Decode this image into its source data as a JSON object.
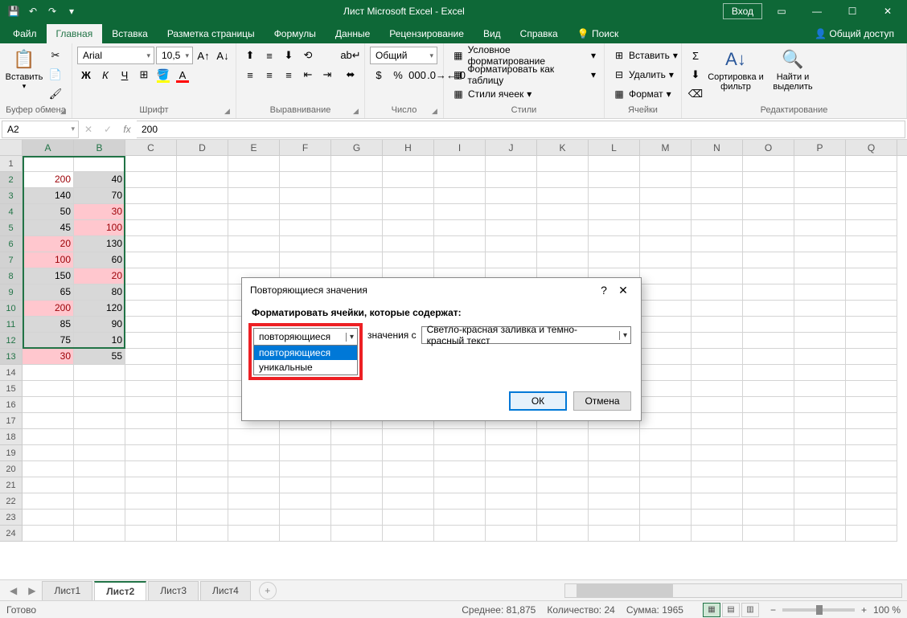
{
  "title": "Лист Microsoft Excel  -  Excel",
  "login": "Вход",
  "tabs": [
    "Файл",
    "Главная",
    "Вставка",
    "Разметка страницы",
    "Формулы",
    "Данные",
    "Рецензирование",
    "Вид",
    "Справка",
    "Поиск"
  ],
  "active_tab": 1,
  "share": "Общий доступ",
  "ribbon": {
    "clipboard": {
      "paste": "Вставить",
      "label": "Буфер обмена"
    },
    "font": {
      "name": "Arial",
      "size": "10,5",
      "label": "Шрифт",
      "bold": "Ж",
      "italic": "К",
      "underline": "Ч"
    },
    "align": {
      "label": "Выравнивание",
      "wrap": ""
    },
    "number": {
      "format": "Общий",
      "label": "Число"
    },
    "styles": {
      "cond": "Условное форматирование",
      "table": "Форматировать как таблицу",
      "cell": "Стили ячеек",
      "label": "Стили"
    },
    "cells": {
      "insert": "Вставить",
      "delete": "Удалить",
      "format": "Формат",
      "label": "Ячейки"
    },
    "editing": {
      "sort": "Сортировка и фильтр",
      "find": "Найти и выделить",
      "label": "Редактирование"
    }
  },
  "namebox": "A2",
  "formula": "200",
  "columns": [
    "A",
    "B",
    "C",
    "D",
    "E",
    "F",
    "G",
    "H",
    "I",
    "J",
    "K",
    "L",
    "M",
    "N",
    "O",
    "P",
    "Q"
  ],
  "rows": [
    1,
    2,
    3,
    4,
    5,
    6,
    7,
    8,
    9,
    10,
    11,
    12,
    13,
    14,
    15,
    16,
    17,
    18,
    19,
    20,
    21,
    22,
    23,
    24
  ],
  "data": {
    "2": {
      "A": "200",
      "B": "40"
    },
    "3": {
      "A": "140",
      "B": "70"
    },
    "4": {
      "A": "50",
      "B": "30"
    },
    "5": {
      "A": "45",
      "B": "100"
    },
    "6": {
      "A": "20",
      "B": "130"
    },
    "7": {
      "A": "100",
      "B": "60"
    },
    "8": {
      "A": "150",
      "B": "20"
    },
    "9": {
      "A": "65",
      "B": "80"
    },
    "10": {
      "A": "200",
      "B": "120"
    },
    "11": {
      "A": "85",
      "B": "90"
    },
    "12": {
      "A": "75",
      "B": "10"
    },
    "13": {
      "A": "30",
      "B": "55"
    }
  },
  "duplicates": {
    "A": [
      "200",
      "20",
      "100",
      "30"
    ],
    "B": [
      "30",
      "100",
      "20"
    ]
  },
  "sheets": [
    "Лист1",
    "Лист2",
    "Лист3",
    "Лист4"
  ],
  "active_sheet": 1,
  "status": {
    "ready": "Готово",
    "avg_lbl": "Среднее:",
    "avg": "81,875",
    "cnt_lbl": "Количество:",
    "cnt": "24",
    "sum_lbl": "Сумма:",
    "sum": "1965",
    "zoom": "100 %"
  },
  "dialog": {
    "title": "Повторяющиеся значения",
    "help": "?",
    "label1": "Форматировать ячейки, которые содержат:",
    "dd_value": "повторяющиеся",
    "dd_options": [
      "повторяющиеся",
      "уникальные"
    ],
    "mid": "значения с",
    "format": "Светло-красная заливка и темно-красный текст",
    "ok": "ОК",
    "cancel": "Отмена"
  }
}
